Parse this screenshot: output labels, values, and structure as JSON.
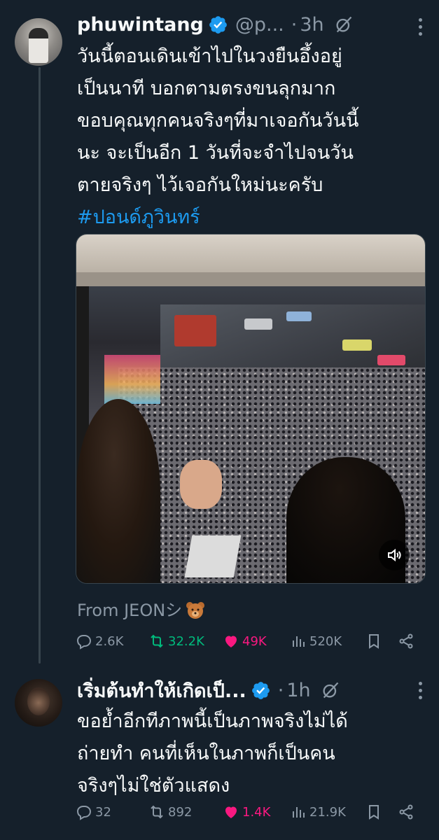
{
  "tweet1": {
    "display_name": "phuwintang",
    "handle": "@p...",
    "separator": "·",
    "time": "3h",
    "text_lines": [
      "วันนี้ตอนเดินเข้าไปในวงยืนอึ้งอยู่",
      "เป็นนาที บอกตามตรงขนลุกมาก",
      "ขอบคุณทุกคนจริงๆที่มาเจอกันวันนี้",
      "นะ จะเป็นอีก 1 วันที่จะจำไปจนวัน",
      "ตายจริงๆ ไว้เจอกันใหม่นะครับ"
    ],
    "hashtag": "#ปอนด์ภูวินทร์",
    "attribution": "From JEONシ",
    "attribution_emoji": "teddy-bear-emoji",
    "stats": {
      "replies": "2.6K",
      "reposts": "32.2K",
      "likes": "49K",
      "views": "520K"
    }
  },
  "tweet2": {
    "display_name": "เริ่มต้นทำให้เกิดเป็...",
    "separator": "·",
    "time": "1h",
    "text_lines": [
      "ขอย้ำอีกทีภาพนี้เป็นภาพจริงไม่ได้",
      "ถ่ายทำ คนที่เห็นในภาพก็เป็นคน",
      "จริงๆไม่ใช่ตัวแสดง"
    ],
    "stats": {
      "replies": "32",
      "reposts": "892",
      "likes": "1.4K",
      "views": "21.9K"
    }
  },
  "colors": {
    "background": "#15202b",
    "text": "#f7f9f9",
    "muted": "#8b98a5",
    "accent": "#1d9bf0",
    "repost": "#00ba7c",
    "like": "#f91880"
  },
  "icons": [
    "verified-badge-icon",
    "grok-icon",
    "more-icon",
    "reply-icon",
    "repost-icon",
    "like-icon",
    "views-icon",
    "bookmark-icon",
    "share-icon",
    "volume-icon"
  ]
}
